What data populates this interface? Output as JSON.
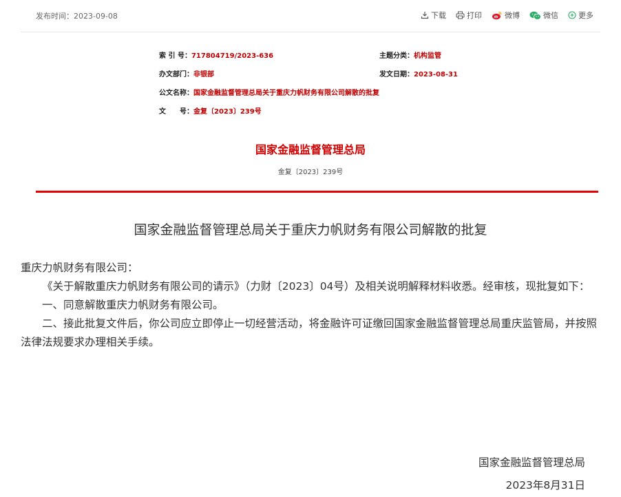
{
  "header": {
    "publish_date": "发布时间：2023-09-08",
    "tools": {
      "download": "下载",
      "print": "打印",
      "weibo": "微博",
      "wechat": "微信",
      "more": "更多"
    }
  },
  "meta": {
    "index_label": "索 引 号：",
    "index_value": "717804719/2023-636",
    "topic_label": "主题分类：",
    "topic_value": "机构监管",
    "dept_label": "办文部门：",
    "dept_value": "非银部",
    "date_label": "发文日期：",
    "date_value": "2023-08-31",
    "name_label": "公文名称：",
    "name_value": "国家金融监督管理总局关于重庆力帆财务有限公司解散的批复",
    "docno_label": "文　　号：",
    "docno_value": "金复〔2023〕239号"
  },
  "document": {
    "issuer": "国家金融监督管理总局",
    "doc_number": "金复〔2023〕239号",
    "title": "国家金融监督管理总局关于重庆力帆财务有限公司解散的批复",
    "salutation": "重庆力帆财务有限公司：",
    "paragraphs": [
      "《关于解散重庆力帆财务有限公司的请示》（力财〔2023〕04号）及相关说明解释材料收悉。经审核，现批复如下：",
      "一、同意解散重庆力帆财务有限公司。",
      "二、接此批复文件后，你公司应立即停止一切经营活动，将金融许可证缴回国家金融监督管理总局重庆监管局，并按照法律法规要求办理相关手续。"
    ],
    "signature": "国家金融监督管理总局",
    "sign_date": "2023年8月31日"
  }
}
